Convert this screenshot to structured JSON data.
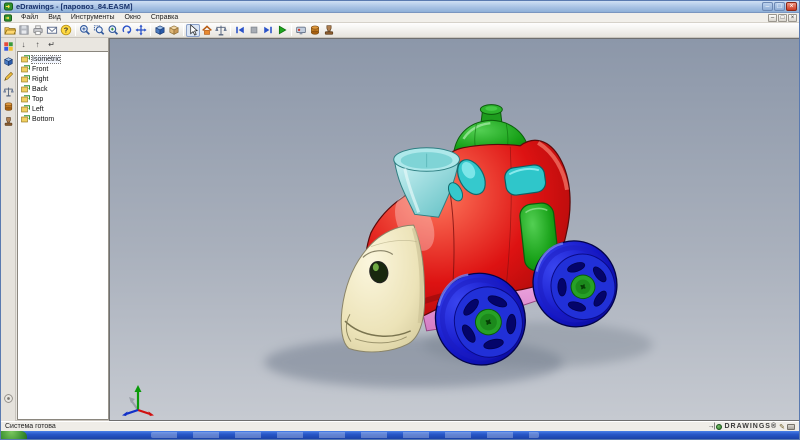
{
  "window": {
    "title": "eDrawings - [паровоз_84.EASM]",
    "controls": {
      "minimize": "–",
      "restore": "□",
      "close": "×"
    }
  },
  "menu": {
    "items": [
      "Файл",
      "Вид",
      "Инструменты",
      "Окно",
      "Справка"
    ],
    "mdi_controls": {
      "minimize": "–",
      "restore": "□",
      "close": "×"
    }
  },
  "toolbar": {
    "icons": [
      "open",
      "save",
      "print",
      "send",
      "help",
      "zoom-in",
      "zoom-area",
      "zoom-fit",
      "rotate-view",
      "pan",
      "shaded-view",
      "wireframe-view",
      "select",
      "home-view",
      "measure",
      "first-frame",
      "stop",
      "last-frame",
      "play",
      "pointer-3d",
      "mass-properties",
      "stamp"
    ]
  },
  "left_tabs": {
    "icons": [
      "views-palette",
      "components",
      "markup",
      "measure-tab",
      "mass-properties-tab",
      "stamp-tab",
      "options"
    ]
  },
  "panel": {
    "buttons": {
      "next_view": "↓",
      "previous_view": "↑",
      "return_view": "↵"
    },
    "views": [
      "Isometric",
      "Front",
      "Right",
      "Back",
      "Top",
      "Left",
      "Bottom"
    ],
    "selected_view": "Isometric"
  },
  "viewport": {
    "triad_axes": [
      "x",
      "y",
      "z"
    ]
  },
  "statusbar": {
    "message": "Система готова",
    "brand_arrow": "→|",
    "brand": "DRAWINGS®",
    "pencil_icon": "✎"
  },
  "colors": {
    "accent_red": "#d01010",
    "model_cream": "#efe8c4",
    "model_teal": "#7fd0d2",
    "model_green": "#1fa51f",
    "model_blue": "#1515c8",
    "model_pink": "#ee9ade",
    "viewport_top": "#8c97a9",
    "viewport_bottom": "#c6cad1"
  }
}
